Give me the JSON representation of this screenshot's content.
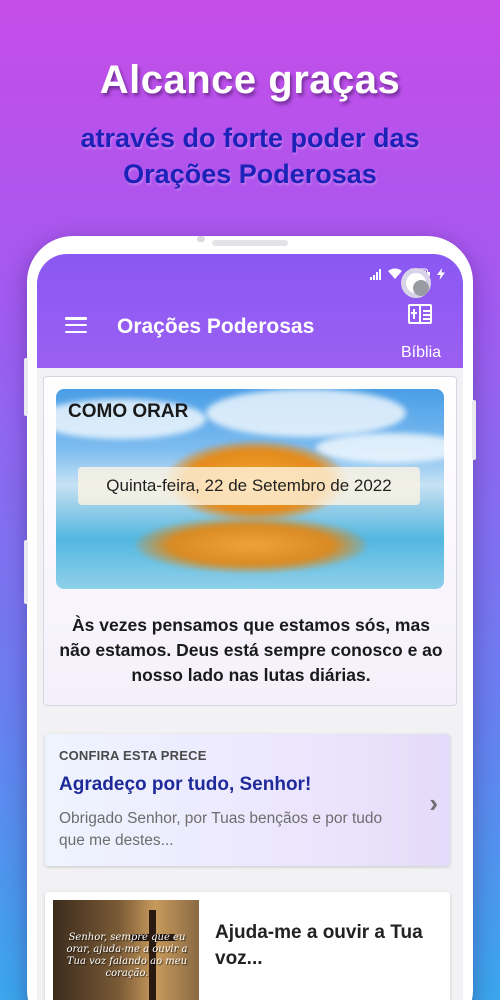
{
  "promo": {
    "title": "Alcance graças",
    "subtitle_line1": "através do forte poder das",
    "subtitle_line2": "Orações Poderosas"
  },
  "app": {
    "title": "Orações Poderosas",
    "bible_label": "Bíblia",
    "icons": {
      "menu": "hamburger-menu-icon",
      "bible": "bible-book-icon",
      "chevron": "chevron-right-icon"
    },
    "colors": {
      "appbar": "#9b5ff2",
      "prece_title": "#1f2a9a"
    }
  },
  "main_card": {
    "hero_title": "COMO ORAR",
    "date": "Quinta-feira, 22 de Setembro de 2022",
    "quote": "Às vezes pensamos que estamos sós, mas não estamos. Deus está sempre conosco e ao nosso lado nas lutas diárias."
  },
  "prece_card": {
    "kicker": "CONFIRA ESTA PRECE",
    "title": "Agradeço por tudo, Senhor!",
    "description": "Obrigado Senhor, por Tuas bençãos e por tudo que me destes..."
  },
  "ajuda_card": {
    "thumb_text": "Senhor, sempre que eu orar, ajuda-me a ouvir a Tua voz falando ao meu coração.",
    "title": "Ajuda-me a ouvir a Tua voz..."
  }
}
